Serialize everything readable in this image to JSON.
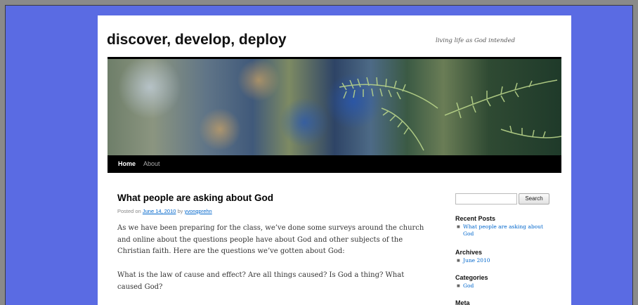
{
  "site": {
    "title": "discover, develop, deploy",
    "description": "living life as God intended"
  },
  "nav": {
    "items": [
      {
        "label": "Home"
      },
      {
        "label": "About"
      }
    ]
  },
  "post": {
    "title": "What people are asking about God",
    "meta_prefix": "Posted on",
    "date": "June 14, 2010",
    "meta_by": "by",
    "author": "yvongprehn",
    "paragraphs": [
      "As we have been preparing for the class, we’ve done some surveys around the church and online about the questions people have about God and other subjects of the Christian faith. Here are the questions we’ve gotten about God:",
      "What is the law of cause and effect?  Are all things caused?  Is God a thing?  What caused God?"
    ]
  },
  "sidebar": {
    "search": {
      "value": "",
      "button_label": "Search"
    },
    "widgets": [
      {
        "title": "Recent Posts",
        "items": [
          "What people are asking about God"
        ]
      },
      {
        "title": "Archives",
        "items": [
          "June 2010"
        ]
      },
      {
        "title": "Categories",
        "items": [
          "God"
        ]
      },
      {
        "title": "Meta",
        "items": []
      }
    ]
  },
  "colors": {
    "background_frame": "#5a6be3",
    "link": "#0066cc",
    "nav_bar": "#000000"
  }
}
